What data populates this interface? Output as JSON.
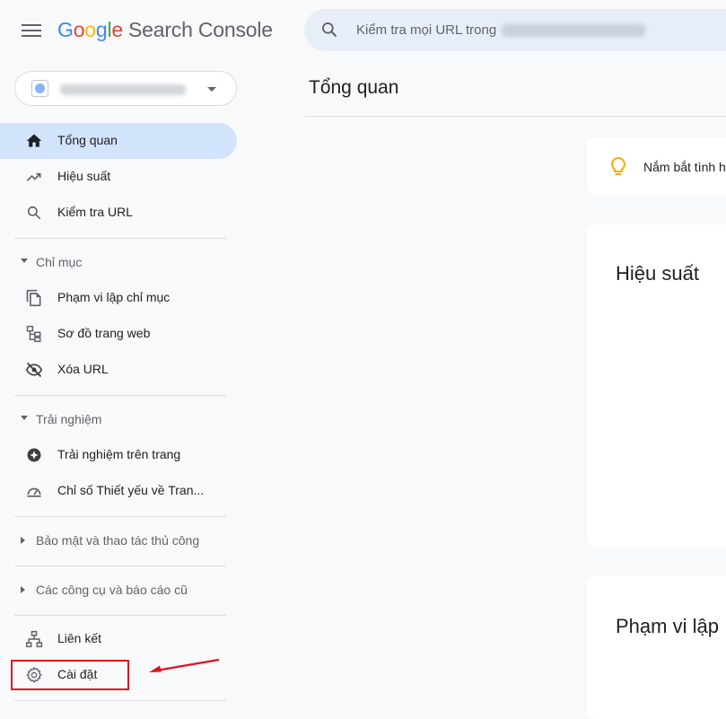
{
  "app": {
    "logo_letters": [
      "G",
      "o",
      "o",
      "g",
      "l",
      "e"
    ],
    "product_name": "Search Console"
  },
  "search": {
    "placeholder": "Kiểm tra mọi URL trong"
  },
  "property": {
    "icon": "globe-icon"
  },
  "sidebar": {
    "items": [
      {
        "label": "Tổng quan",
        "icon": "home-icon",
        "active": true
      },
      {
        "label": "Hiệu suất",
        "icon": "trending-up-icon"
      },
      {
        "label": "Kiểm tra URL",
        "icon": "search-icon"
      }
    ],
    "sections": [
      {
        "label": "Chỉ mục",
        "expanded": true,
        "items": [
          {
            "label": "Phạm vi lập chỉ mục",
            "icon": "copy-pages-icon"
          },
          {
            "label": "Sơ đồ trang web",
            "icon": "sitemap-icon"
          },
          {
            "label": "Xóa URL",
            "icon": "visibility-off-icon"
          }
        ]
      },
      {
        "label": "Trải nghiệm",
        "expanded": true,
        "items": [
          {
            "label": "Trải nghiệm trên trang",
            "icon": "plus-circle-icon"
          },
          {
            "label": "Chỉ số Thiết yếu về Tran...",
            "icon": "speedometer-icon"
          }
        ]
      },
      {
        "label": "Bảo mật và thao tác thủ công",
        "expanded": false
      },
      {
        "label": "Các công cụ và báo cáo cũ",
        "expanded": false
      }
    ],
    "bottom_items": [
      {
        "label": "Liên kết",
        "icon": "network-icon"
      },
      {
        "label": "Cài đặt",
        "icon": "gear-icon"
      }
    ]
  },
  "main": {
    "page_title": "Tổng quan",
    "tip_text": "Nắm bắt tình h",
    "cards": [
      {
        "title": "Hiệu suất"
      },
      {
        "title": "Phạm vi lập"
      }
    ]
  },
  "colors": {
    "active_bg": "#d2e3fc",
    "highlight_box": "#e0141e",
    "bulb": "#f9ab00"
  }
}
